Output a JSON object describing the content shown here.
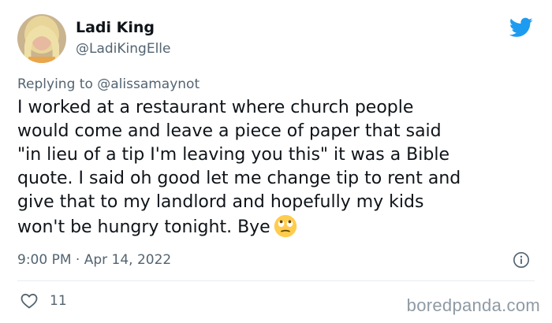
{
  "tweet": {
    "author": {
      "display_name": "Ladi King",
      "handle": "@LadiKingElle",
      "avatar": "profile-photo"
    },
    "replying_prefix": "Replying to",
    "replying_to": "@alissamaynot",
    "text_lines": [
      "I worked at a restaurant where church people",
      "would come and leave a piece of paper that said",
      "\"in lieu of a tip I'm leaving you this\" it was a Bible",
      "quote. I said oh good let me change tip to rent and",
      "give that to my landlord and hopefully my kids",
      "won't be hungry tonight. Bye"
    ],
    "emoji": "face-with-rolling-eyes",
    "timestamp": "9:00 PM · Apr 14, 2022",
    "like_count": "11",
    "icons": {
      "brand": "twitter-bird-icon",
      "info": "info-icon",
      "like": "heart-icon"
    }
  },
  "watermark": "boredpanda.com",
  "colors": {
    "brand_blue": "#1d9bf0",
    "text_primary": "#0f1419",
    "text_secondary": "#536471",
    "divider": "#e6ecf0",
    "watermark": "#8f9aa3"
  }
}
